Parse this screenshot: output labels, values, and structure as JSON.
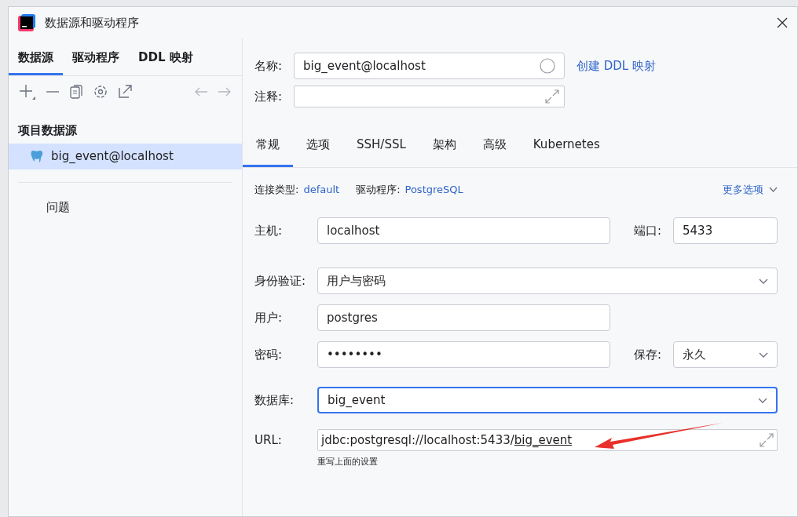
{
  "window": {
    "title": "数据源和驱动程序"
  },
  "left": {
    "tabs": [
      {
        "label": "数据源",
        "selected": true
      },
      {
        "label": "驱动程序",
        "selected": false
      },
      {
        "label": "DDL 映射",
        "selected": false
      }
    ],
    "section_title": "项目数据源",
    "datasources": [
      {
        "name": "big_event@localhost",
        "selected": true
      }
    ],
    "problems": "问题"
  },
  "right": {
    "name": {
      "label": "名称:",
      "value": "big_event@localhost"
    },
    "create_ddl_link": "创建 DDL 映射",
    "comment": {
      "label": "注释:"
    },
    "tabs": [
      {
        "label": "常规",
        "selected": true
      },
      {
        "label": "选项",
        "selected": false
      },
      {
        "label": "SSH/SSL",
        "selected": false
      },
      {
        "label": "架构",
        "selected": false
      },
      {
        "label": "高级",
        "selected": false
      },
      {
        "label": "Kubernetes",
        "selected": false
      }
    ],
    "connection_type": {
      "label": "连接类型:",
      "value": "default"
    },
    "driver": {
      "label": "驱动程序:",
      "value": "PostgreSQL"
    },
    "more_options": "更多选项",
    "rows": [
      [
        {
          "label": "主机:",
          "value": "localhost",
          "kind": "text",
          "focused": false
        },
        {
          "label": "端口:",
          "value": "5433",
          "kind": "text",
          "focused": false
        }
      ],
      [
        {
          "label": "身份验证:",
          "value": "用户与密码",
          "kind": "select",
          "focused": false
        }
      ],
      [
        {
          "label": "用户:",
          "value": "postgres",
          "kind": "text",
          "focused": false
        }
      ],
      [
        {
          "label": "密码:",
          "value": "••••••••",
          "kind": "text",
          "focused": false
        },
        {
          "label": "保存:",
          "value": "永久",
          "kind": "select",
          "focused": false
        }
      ],
      [
        {
          "label": "数据库:",
          "value": "big_event",
          "kind": "select",
          "focused": true
        }
      ]
    ],
    "url": {
      "label": "URL:",
      "prefix": "jdbc:postgresql://localhost:5433/",
      "database": "big_event",
      "hint": "重写上面的设置"
    }
  }
}
